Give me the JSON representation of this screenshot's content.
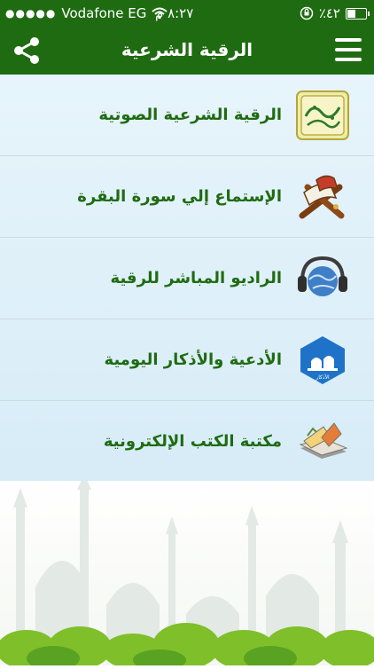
{
  "status_bar": {
    "carrier": "Vodafone EG",
    "time": "٨:٢٧ م",
    "battery": "٪٤٢"
  },
  "navbar": {
    "title": "الرقية الشرعية"
  },
  "menu_items": [
    {
      "label": "الرقية الشرعية الصوتية",
      "icon": "roqya-emblem-icon"
    },
    {
      "label": "الإستماع إلي سورة البقرة",
      "icon": "quran-stand-icon"
    },
    {
      "label": "الراديو المباشر للرقية",
      "icon": "headphones-globe-icon"
    },
    {
      "label": "الأدعية والأذكار اليومية",
      "icon": "mosque-badge-icon"
    },
    {
      "label": "مكتبة الكتب الإلكترونية",
      "icon": "books-icon"
    }
  ],
  "icon_badges": {
    "azkar": "الأذكار"
  },
  "colors": {
    "brand_green": "#1f6b12",
    "list_bg": "#e7f4fb"
  }
}
